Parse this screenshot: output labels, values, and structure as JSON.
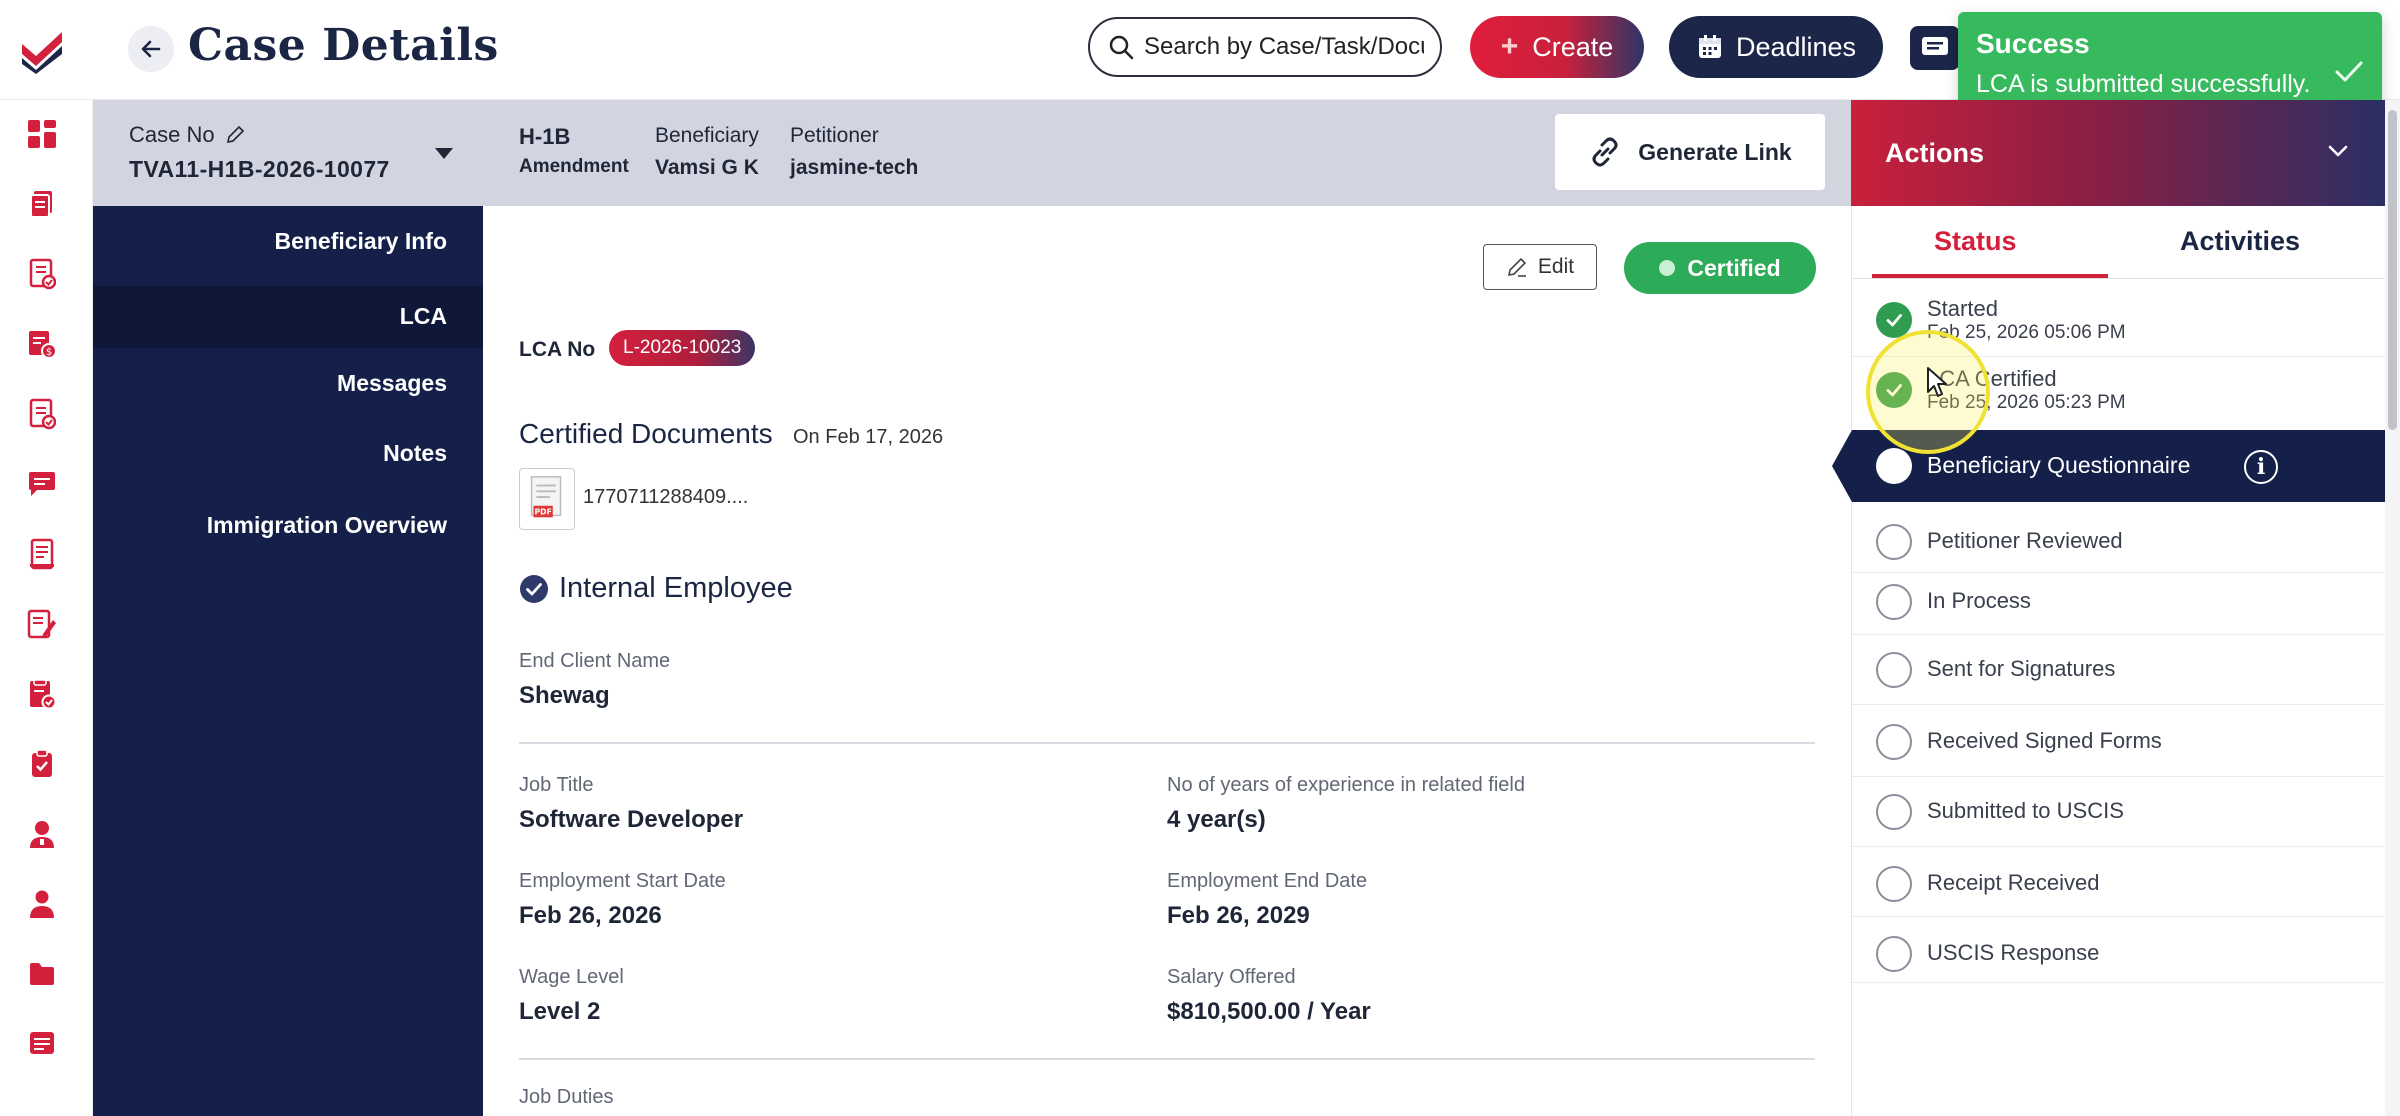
{
  "header": {
    "title": "Case Details",
    "search_placeholder": "Search by Case/Task/Docu",
    "create_label": "Create",
    "deadlines_label": "Deadlines"
  },
  "toast": {
    "title": "Success",
    "message": "LCA is submitted successfully."
  },
  "rail": {
    "icons": [
      "dashboard-icon",
      "cases-icon",
      "tasks-icon",
      "invoice-icon",
      "forms-icon",
      "chat-icon",
      "reports-icon",
      "notes-icon",
      "documents-icon",
      "clipboard-icon",
      "user-icon",
      "employees-icon",
      "folder-icon",
      "messages-icon"
    ]
  },
  "case": {
    "case_no_label": "Case No",
    "case_no": "TVA11-H1B-2026-10077",
    "visa_type": "H-1B",
    "visa_sub": "Amendment",
    "beneficiary_label": "Beneficiary",
    "beneficiary": "Vamsi G K",
    "petitioner_label": "Petitioner",
    "petitioner": "jasmine-tech",
    "generate_link_label": "Generate Link"
  },
  "sidenav": {
    "items": [
      "Beneficiary Info",
      "LCA",
      "Messages",
      "Notes",
      "Immigration Overview"
    ],
    "active": "LCA"
  },
  "lca": {
    "edit_label": "Edit",
    "status_badge": "Certified",
    "lca_no_label": "LCA No",
    "lca_no": "L-2026-10023",
    "cert_docs_title": "Certified Documents",
    "cert_docs_date": "On Feb 17, 2026",
    "file_name": "1770711288409....",
    "employee_type": "Internal Employee",
    "fields": {
      "end_client_label": "End Client Name",
      "end_client": "Shewag",
      "job_title_label": "Job Title",
      "job_title": "Software Developer",
      "experience_label": "No of years of experience in related field",
      "experience": "4 year(s)",
      "start_label": "Employment Start Date",
      "start": "Feb 26, 2026",
      "end_label": "Employment End Date",
      "end": "Feb 26, 2029",
      "wage_label": "Wage Level",
      "wage": "Level 2",
      "salary_label": "Salary Offered",
      "salary": "$810,500.00 / Year",
      "duties_label": "Job Duties"
    }
  },
  "actions": {
    "title": "Actions",
    "tabs": [
      "Status",
      "Activities"
    ],
    "active_tab": "Status",
    "steps": [
      {
        "name": "Started",
        "date": "Feb 25, 2026 05:06 PM",
        "done": true
      },
      {
        "name": "LCA Certified",
        "date": "Feb 25, 2026 05:23 PM",
        "done": true
      },
      {
        "name": "Beneficiary Questionnaire",
        "active": true
      },
      {
        "name": "Petitioner Reviewed"
      },
      {
        "name": "In Process"
      },
      {
        "name": "Sent for Signatures"
      },
      {
        "name": "Received Signed Forms"
      },
      {
        "name": "Submitted to USCIS"
      },
      {
        "name": "Receipt Received"
      },
      {
        "name": "USCIS Response"
      }
    ]
  },
  "colors": {
    "navy": "#15204a",
    "brand_red": "#d3213d",
    "success_green": "#37b95e",
    "certified_green": "#2cab58"
  }
}
